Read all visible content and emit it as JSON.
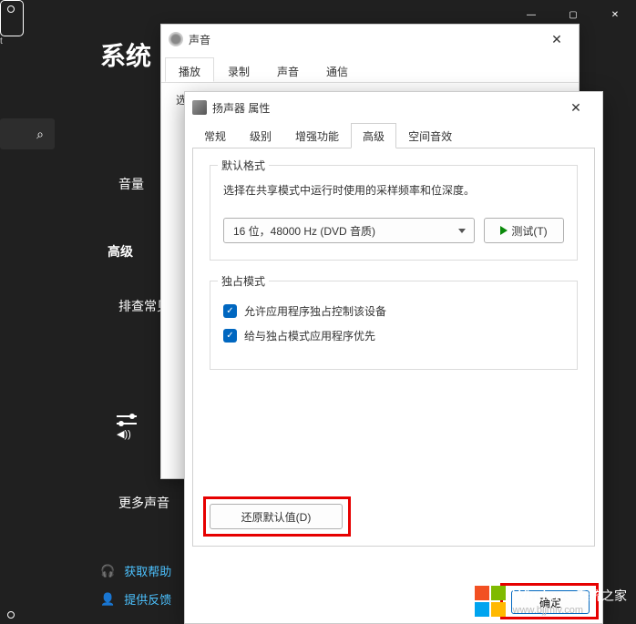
{
  "settings": {
    "heading": "系统",
    "sidetext": "t",
    "items": {
      "volume": "音量",
      "advanced_heading": "高级",
      "troubleshoot": "排查常见",
      "more_sound": "更多声音"
    },
    "help": {
      "get_help": "获取帮助",
      "feedback": "提供反馈"
    }
  },
  "sound_dialog": {
    "title": "声音",
    "tabs": [
      "播放",
      "录制",
      "声音",
      "通信"
    ],
    "active_tab_index": 0,
    "body_label": "选"
  },
  "props_dialog": {
    "title": "扬声器 属性",
    "tabs": [
      "常规",
      "级别",
      "增强功能",
      "高级",
      "空间音效"
    ],
    "active_tab_index": 3,
    "default_format": {
      "group_title": "默认格式",
      "desc": "选择在共享模式中运行时使用的采样频率和位深度。",
      "selected": "16 位，48000 Hz (DVD 音质)",
      "test_label": "测试(T)"
    },
    "exclusive": {
      "group_title": "独占模式",
      "opt1": "允许应用程序独占控制该设备",
      "opt2": "给与独占模式应用程序优先"
    },
    "restore_label": "还原默认值(D)",
    "ok_label": "确定"
  },
  "watermark": {
    "brand": "Windows",
    "sub_brand": "系统之家",
    "url": "www.bjjmlv.com"
  },
  "glyphs": {
    "minimize": "—",
    "maximize": "▢",
    "close": "✕",
    "search": "⌕",
    "check": "✓",
    "sliders": "⎓",
    "speaker": "🔊",
    "headset": "🎧",
    "person": "👤"
  }
}
